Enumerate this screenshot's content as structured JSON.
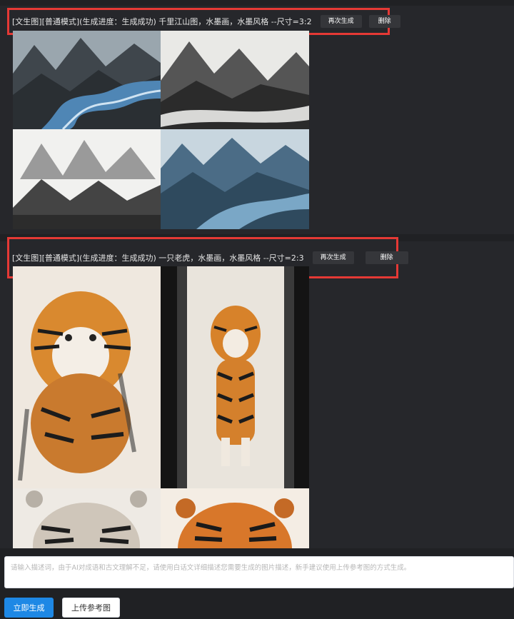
{
  "feed": {
    "cards": [
      {
        "title": "[文生图][普通模式](生成进度：生成成功) 千里江山图，水墨画，水墨风格 --尺寸=3:2",
        "regenerate_label": "再次生成",
        "delete_label": "删除"
      },
      {
        "title": "[文生图][普通模式](生成进度：生成成功) 一只老虎，水墨画，水墨风格 --尺寸=2:3",
        "regenerate_label": "再次生成",
        "delete_label": "删除"
      }
    ]
  },
  "composer": {
    "placeholder": "请输入描述词，由于AI对成语和古文理解不足，请使用白话文详细描述您需要生成的图片描述，新手建议使用上传参考图的方式生成。",
    "generate_label": "立即生成",
    "upload_label": "上传参考图"
  },
  "colors": {
    "background": "#202124",
    "card": "#26272b",
    "highlight_border": "#e53935",
    "primary": "#1e88e5"
  }
}
